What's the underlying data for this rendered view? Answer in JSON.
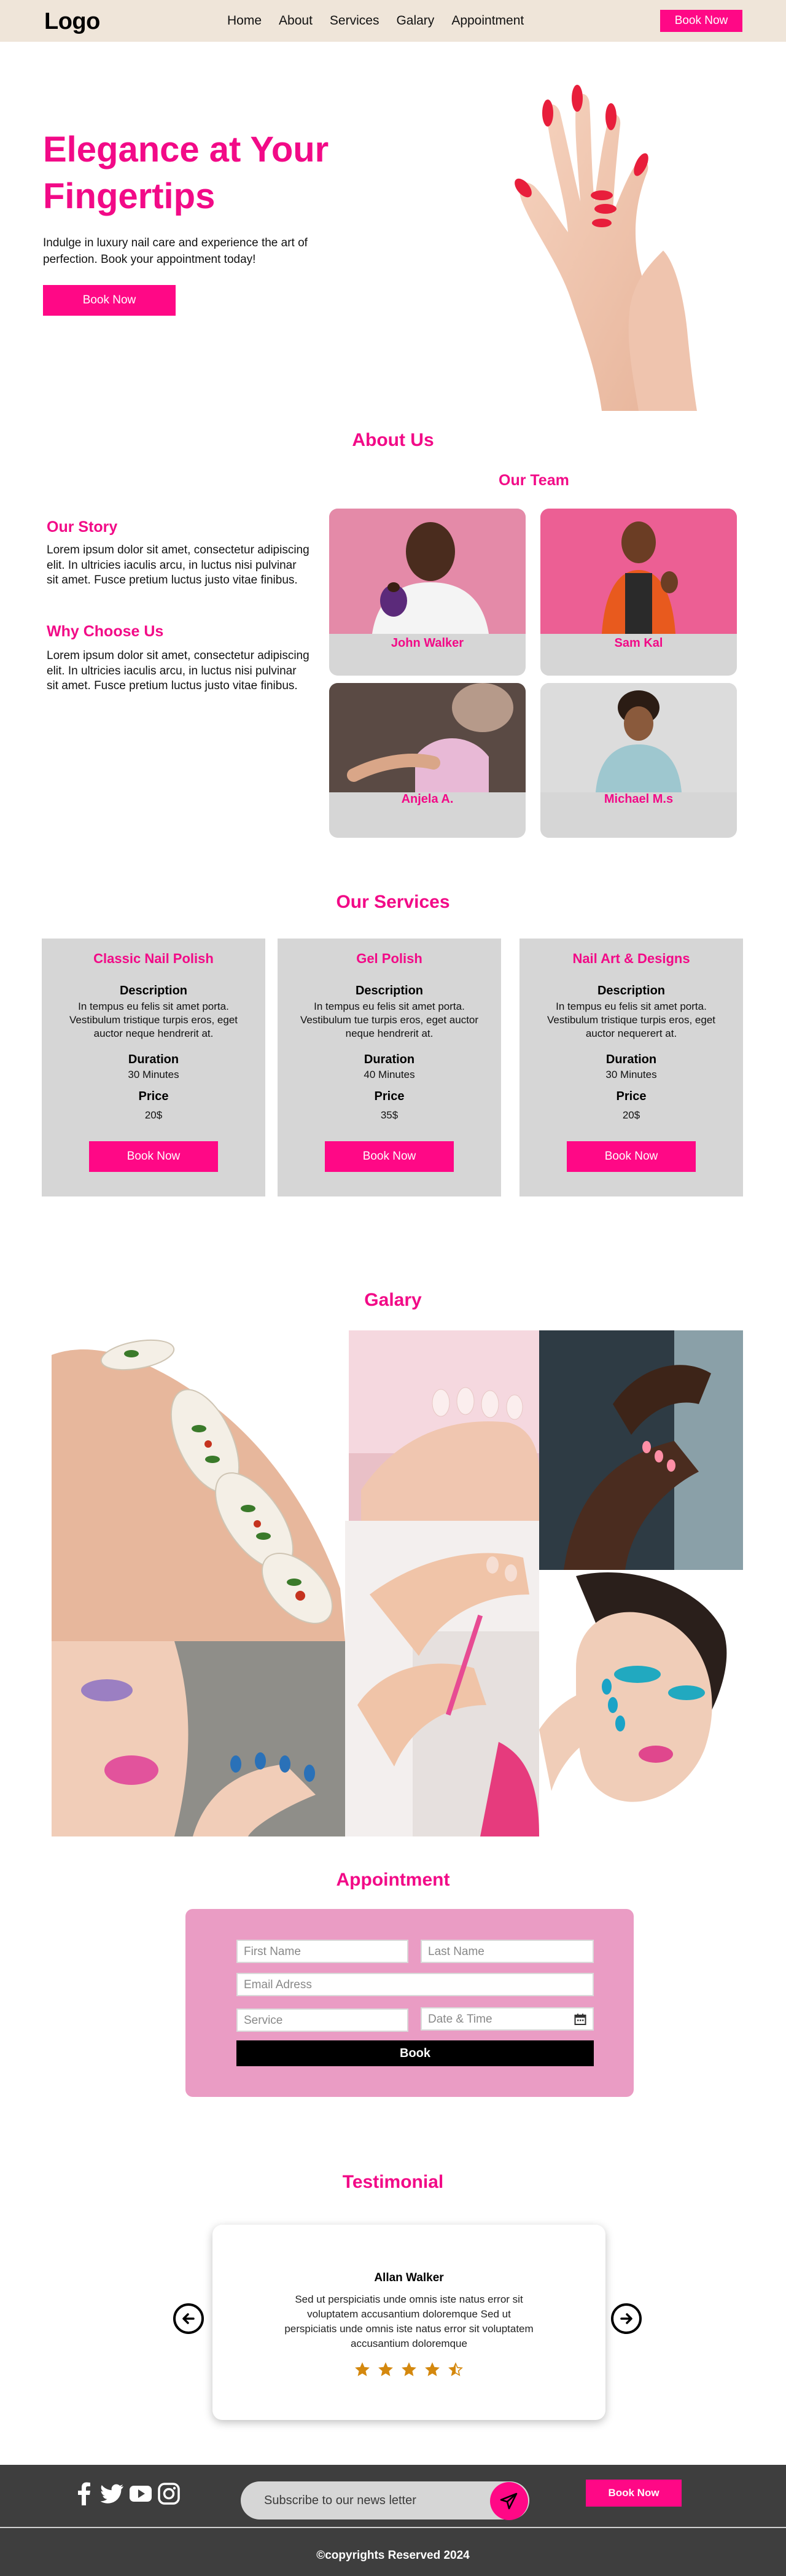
{
  "nav": {
    "logo": "Logo",
    "links": [
      "Home",
      "About",
      "Services",
      "Galary",
      "Appointment"
    ],
    "book_label": "Book Now"
  },
  "hero": {
    "title": "Elegance at Your Fingertips",
    "subtitle": "Indulge in luxury nail care and experience the art of perfection. Book your appointment today!",
    "book_label": "Book Now"
  },
  "about": {
    "heading": "About Us",
    "story_title": "Our Story",
    "story_text": "Lorem ipsum dolor sit amet, consectetur adipiscing elit. In ultricies iaculis arcu, in luctus nisi pulvinar sit amet. Fusce pretium luctus justo vitae finibus.",
    "why_title": "Why Choose Us",
    "why_text": "Lorem ipsum dolor sit amet, consectetur adipiscing elit. In ultricies iaculis arcu, in luctus nisi pulvinar sit amet. Fusce pretium luctus justo vitae finibus.",
    "team_title": "Our Team",
    "team": [
      {
        "name": "John Walker"
      },
      {
        "name": "Sam Kal"
      },
      {
        "name": "Anjela A."
      },
      {
        "name": "Michael M.s"
      }
    ]
  },
  "services": {
    "heading": "Our Services",
    "description_label": "Description",
    "duration_label": "Duration",
    "price_label": "Price",
    "book_label": "Book Now",
    "items": [
      {
        "title": "Classic Nail Polish",
        "description": "In tempus eu felis sit amet porta. Vestibulum tristique turpis eros, eget auctor neque hendrerit at.",
        "duration": "30 Minutes",
        "price": "20$"
      },
      {
        "title": "Gel Polish",
        "description": "In tempus eu felis sit amet porta. Vestibulum tue turpis eros, eget auctor neque hendrerit at.",
        "duration": "40 Minutes",
        "price": "35$"
      },
      {
        "title": "Nail Art & Designs",
        "description": "In tempus eu felis sit amet porta. Vestibulum tristique turpis eros, eget auctor nequerert at.",
        "duration": "30 Minutes",
        "price": "20$"
      }
    ]
  },
  "gallery": {
    "heading": "Galary"
  },
  "appointment": {
    "heading": "Appointment",
    "first_name_ph": "First Name",
    "last_name_ph": "Last Name",
    "email_ph": "Email Adress",
    "service_ph": "Service",
    "date_ph": "Date & Time",
    "book_label": "Book"
  },
  "testimonial": {
    "heading": "Testimonial",
    "name": "Allan Walker",
    "text": "Sed ut perspiciatis unde omnis iste natus error sit voluptatem accusantium doloremque Sed ut perspiciatis unde omnis iste natus error sit voluptatem accusantium doloremque",
    "rating": 4.5,
    "rating_max": 5
  },
  "footer": {
    "newsletter_ph": "Subscribe to our news letter",
    "book_label": "Book Now",
    "copyright": "©copyrights Reserved 2024"
  },
  "colors": {
    "accent": "#ff0886",
    "nav_bg": "#efe5d9",
    "card_bg": "#d6d6d6",
    "appointment_bg": "#ea9cc4",
    "footer_bg": "#3e3e3e",
    "star": "#d4880e"
  }
}
